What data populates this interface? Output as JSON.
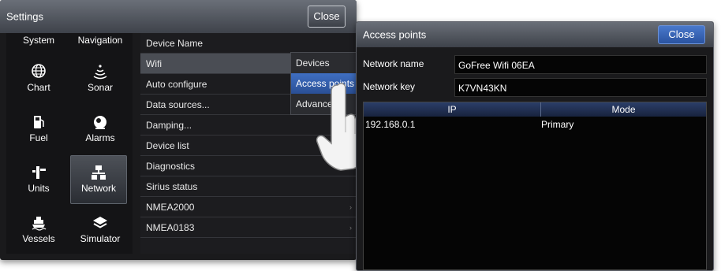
{
  "settings": {
    "title": "Settings",
    "close_label": "Close",
    "categories": [
      {
        "label": "System",
        "icon": "system-icon"
      },
      {
        "label": "Navigation",
        "icon": "navigation-icon"
      },
      {
        "label": "Chart",
        "icon": "globe-icon"
      },
      {
        "label": "Sonar",
        "icon": "sonar-icon"
      },
      {
        "label": "Fuel",
        "icon": "fuel-pump-icon"
      },
      {
        "label": "Alarms",
        "icon": "alarm-bell-icon"
      },
      {
        "label": "Units",
        "icon": "units-icon"
      },
      {
        "label": "Network",
        "icon": "network-icon"
      },
      {
        "label": "Vessels",
        "icon": "vessel-icon"
      },
      {
        "label": "Simulator",
        "icon": "layers-icon"
      }
    ],
    "selected_category": "Network",
    "menu_items": [
      {
        "label": "Device Name"
      },
      {
        "label": "Wifi"
      },
      {
        "label": "Auto configure"
      },
      {
        "label": "Data sources..."
      },
      {
        "label": "Damping..."
      },
      {
        "label": "Device list"
      },
      {
        "label": "Diagnostics"
      },
      {
        "label": "Sirius status"
      },
      {
        "label": "NMEA2000"
      },
      {
        "label": "NMEA0183"
      }
    ],
    "submenu": [
      "Devices",
      "Access points",
      "Advanced"
    ]
  },
  "access_points": {
    "title": "Access points",
    "close_label": "Close",
    "network_name_label": "Network name",
    "network_name_value": "GoFree Wifi 06EA",
    "network_key_label": "Network key",
    "network_key_value": "K7VN43KN",
    "columns": [
      "IP",
      "Mode"
    ],
    "rows": [
      {
        "ip": "192.168.0.1",
        "mode": "Primary"
      }
    ]
  },
  "colors": {
    "accent_blue": "#3a67b8",
    "background": "#1a1a1c"
  }
}
